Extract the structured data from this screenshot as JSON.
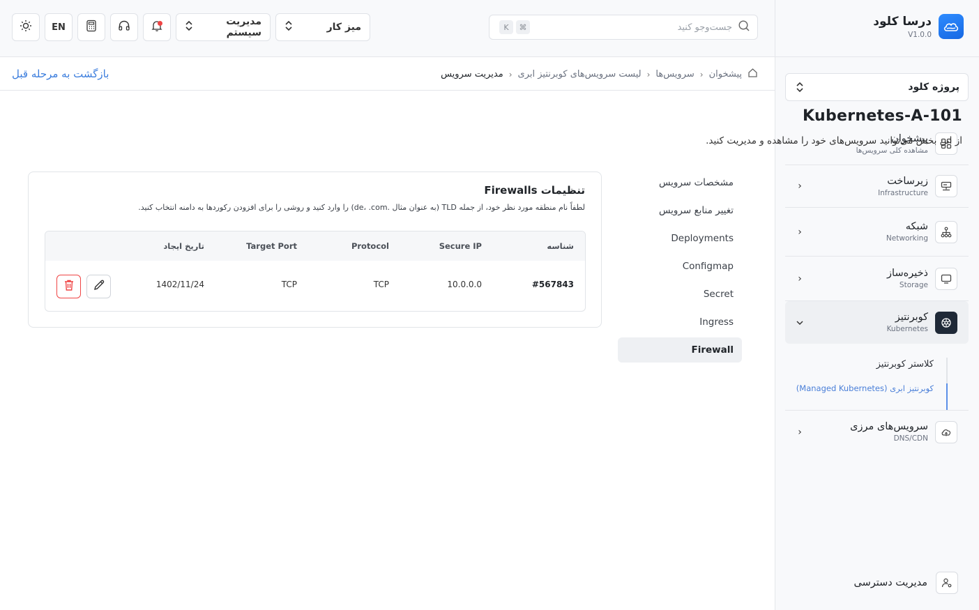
{
  "brand": {
    "name": "درسا کلود",
    "version": "V1.0.0"
  },
  "project_select": {
    "label": "پروژه کلود"
  },
  "nav": {
    "items": [
      {
        "title": "پیشخوان",
        "subtitle": "مشاهده کلی سرویس‌ها",
        "icon": "grid-icon"
      },
      {
        "title": "زیرساخت",
        "subtitle": "Infrastructure",
        "icon": "server-icon"
      },
      {
        "title": "شبکه",
        "subtitle": "Networking",
        "icon": "network-icon"
      },
      {
        "title": "ذخیره‌ساز",
        "subtitle": "Storage",
        "icon": "storage-icon"
      },
      {
        "title": "کوبرنتیز",
        "subtitle": "Kubernetes",
        "icon": "kubernetes-icon"
      },
      {
        "title": "سرویس‌های مرزی",
        "subtitle": "DNS/CDN",
        "icon": "cloud-icon"
      }
    ],
    "kubernetes_sub": [
      {
        "label": "کلاستر کوبرنتیز"
      },
      {
        "label": "کوبرنتیز ابری (Managed Kubernetes)"
      }
    ],
    "access": {
      "title": "مدیریت دسترسی"
    }
  },
  "topbar": {
    "search_placeholder": "جست‌وجو کنید",
    "kbd_cmd": "⌘",
    "kbd_k": "K",
    "workspace": "میز کار",
    "system_admin": "مدیریت سیستم",
    "lang": "EN"
  },
  "breadcrumb": {
    "items": [
      "پیشخوان",
      "سرویس‌ها",
      "لیست سرویس‌های کوبرنتیز ابری",
      "مدیریت سرویس"
    ],
    "back": "بازگشت به مرحله قبل"
  },
  "page": {
    "title": "Kubernetes-A-101",
    "description": "از این بخش می‌توانید سرویس‌های خود را مشاهده و مدیریت کنید."
  },
  "tabs": [
    "مشخصات سرویس",
    "تغییر منابع سرویس",
    "Deployments",
    "Configmap",
    "Secret",
    "Ingress",
    "Firewall"
  ],
  "card": {
    "title": "تنظیمات Firewalls",
    "description": "لطفاً نام منطقه مورد نظر خود، از جمله TLD (به عنوان مثال .de، .com) را وارد کنید و روشی را برای افزودن رکوردها به دامنه انتخاب کنید."
  },
  "table": {
    "headers": {
      "id": "شناسه",
      "secure_ip": "Secure IP",
      "protocol": "Protocol",
      "target_port": "Target Port",
      "created": "تاریخ ایجاد"
    },
    "rows": [
      {
        "id": "#567843",
        "secure_ip": "10.0.0.0",
        "protocol": "TCP",
        "target_port": "TCP",
        "created": "1402/11/24"
      }
    ]
  },
  "colors": {
    "accent": "#3b7ddd",
    "danger": "#ef4444",
    "active_dark": "#1f2937"
  }
}
